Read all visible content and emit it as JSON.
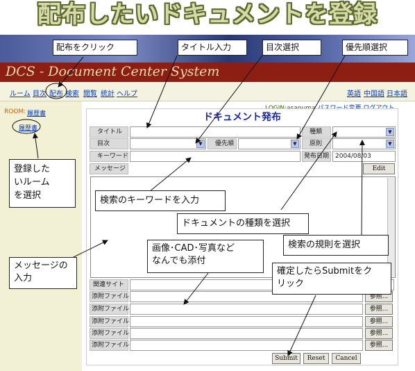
{
  "headline": "配布したいドキュメントを登録",
  "system_title": "DCS - Document Center System",
  "nav": {
    "items": [
      "ルーム",
      "目次",
      "配布",
      "検索",
      "閲覧",
      "統計",
      "ヘルプ"
    ],
    "languages": [
      "英語",
      "中国語",
      "日本語"
    ]
  },
  "sidebar": {
    "room_label": "ROOM:",
    "room_link": "履歴書",
    "room_item": "履歴書"
  },
  "login": {
    "text": "LOGIN:asanuma",
    "change_password": "パスワード変更",
    "logout": "ログアウト"
  },
  "form": {
    "title": "ドキュメント発布",
    "title_label": "タイトル",
    "contents_label": "目次",
    "priority_label": "優先順",
    "type_label": "種類",
    "rule_label": "原則",
    "keyword_label": "キーワード",
    "issue_date_label": "発布日期",
    "issue_date_value": "2004/08/03",
    "message_label": "メッセージ",
    "edit_button": "Edit",
    "related_site_label": "関連サイト",
    "attachment_label": "添附ファイル",
    "browse_button": "参照...",
    "submit_button": "Submit",
    "reset_button": "Reset",
    "cancel_button": "Cancel"
  },
  "callouts": {
    "distribute_click": "配布をクリック",
    "title_input": "タイトル入力",
    "contents_select": "目次選択",
    "priority_select": "優先順選択",
    "select_room": [
      "登録した",
      "いルーム",
      "を選択"
    ],
    "keyword_input": "検索のキーワードを入力",
    "doc_type_select": "ドキュメントの種類を選択",
    "rule_select": "検索の規則を選択",
    "message_input": [
      "メッセージの",
      "入力"
    ],
    "attach_anything": [
      "画像･CAD･写真など",
      "なんでも添付"
    ],
    "submit_hint": [
      "確定したらSubmitをク",
      "リック"
    ]
  }
}
